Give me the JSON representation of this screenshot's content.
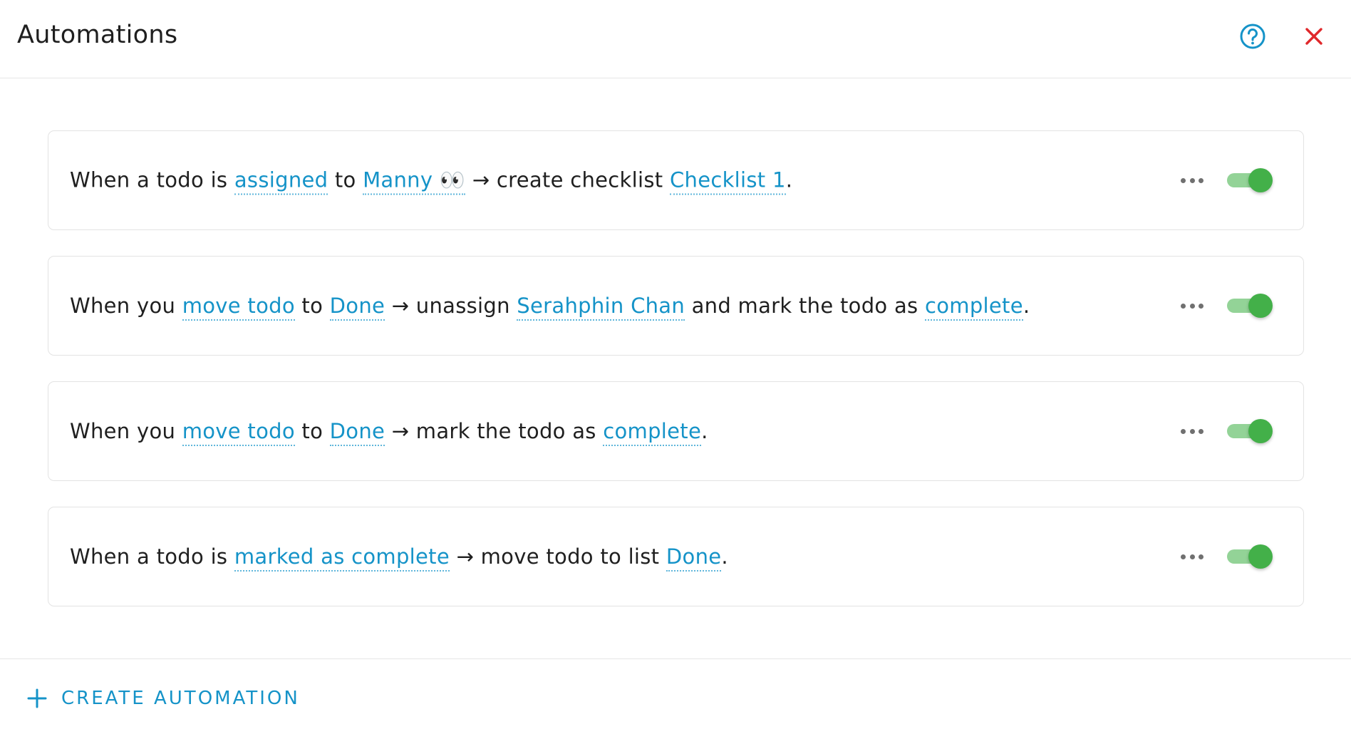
{
  "header": {
    "title": "Automations",
    "help_icon": "question-circle-icon",
    "close_icon": "close-x-icon",
    "accent_color": "#1593c8",
    "close_color": "#e0282b"
  },
  "automations": [
    {
      "enabled": true,
      "tokens": [
        {
          "t": "When a todo is "
        },
        {
          "t": "assigned",
          "link": true
        },
        {
          "t": " to "
        },
        {
          "t": "Manny 👀",
          "link": true
        },
        {
          "t": " → create checklist "
        },
        {
          "t": "Checklist 1",
          "link": true
        },
        {
          "t": "."
        }
      ]
    },
    {
      "enabled": true,
      "tokens": [
        {
          "t": "When you "
        },
        {
          "t": "move todo",
          "link": true
        },
        {
          "t": " to "
        },
        {
          "t": "Done",
          "link": true
        },
        {
          "t": " → unassign "
        },
        {
          "t": "Serahphin Chan",
          "link": true
        },
        {
          "t": " and mark the todo as "
        },
        {
          "t": "complete",
          "link": true
        },
        {
          "t": "."
        }
      ]
    },
    {
      "enabled": true,
      "tokens": [
        {
          "t": "When you "
        },
        {
          "t": "move todo",
          "link": true
        },
        {
          "t": " to "
        },
        {
          "t": "Done",
          "link": true
        },
        {
          "t": " → mark the todo as "
        },
        {
          "t": "complete",
          "link": true
        },
        {
          "t": "."
        }
      ]
    },
    {
      "enabled": true,
      "tokens": [
        {
          "t": "When a todo is "
        },
        {
          "t": "marked as complete",
          "link": true
        },
        {
          "t": " → move todo to list "
        },
        {
          "t": "Done",
          "link": true
        },
        {
          "t": "."
        }
      ]
    }
  ],
  "footer": {
    "create_label": "CREATE AUTOMATION",
    "create_icon": "plus-icon"
  },
  "colors": {
    "toggle_on_track": "#93d397",
    "toggle_on_knob": "#43b049"
  }
}
